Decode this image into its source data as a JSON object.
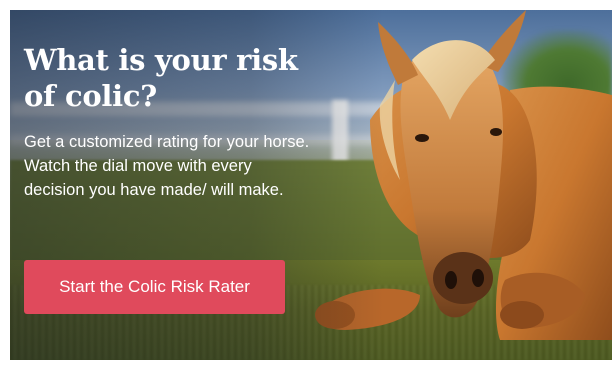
{
  "banner": {
    "headline": "What is your risk of colic?",
    "description": "Get a customized rating for your horse. Watch the dial move with every decision you have made/ will make.",
    "cta_label": "Start the Colic Risk Rater",
    "cta_color": "#e04a5c"
  },
  "photo": {
    "subject": "palomino horse lying in pasture"
  }
}
